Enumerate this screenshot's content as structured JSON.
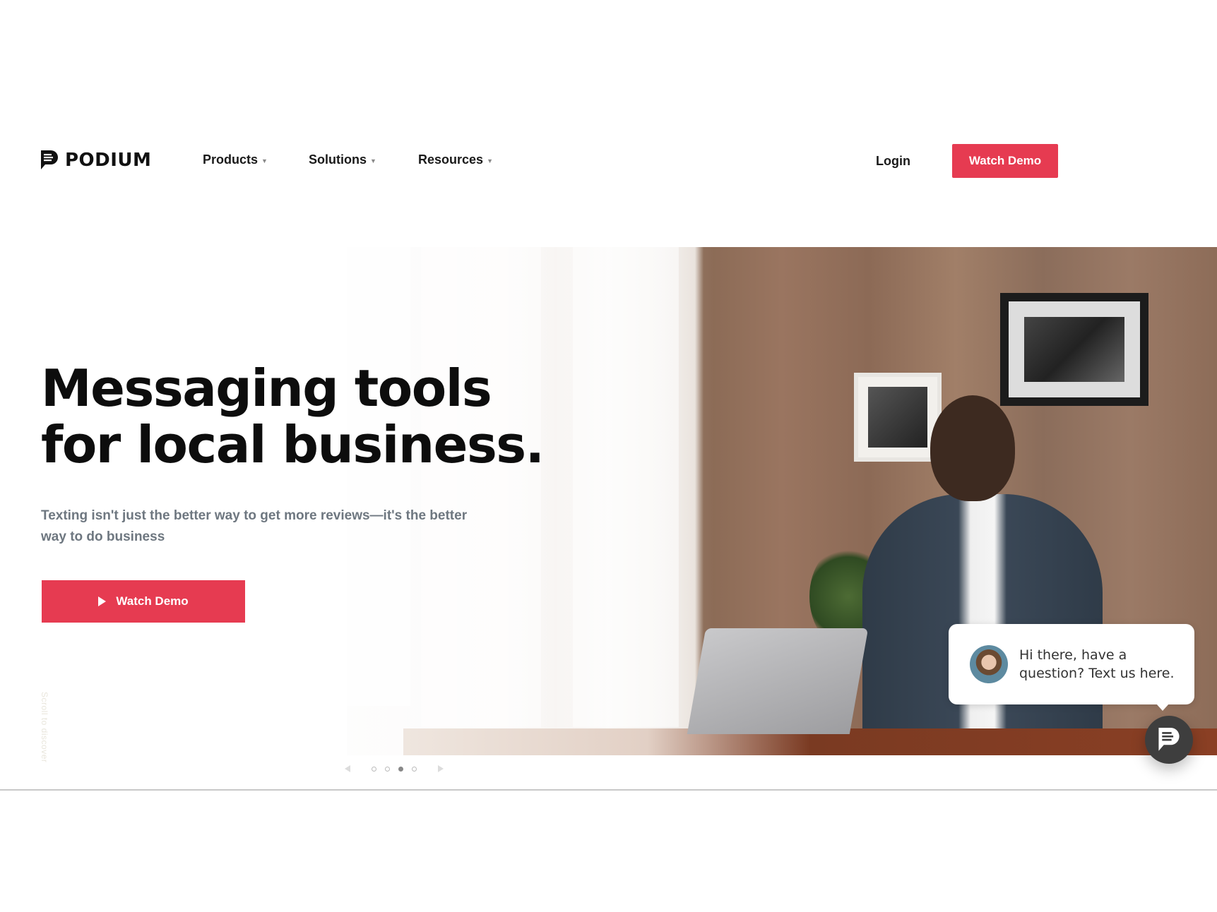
{
  "header": {
    "logo_text": "PODIUM",
    "nav": [
      {
        "label": "Products",
        "icon": "chevron-down-icon"
      },
      {
        "label": "Solutions",
        "icon": "chevron-down-icon"
      },
      {
        "label": "Resources",
        "icon": "chevron-down-icon"
      }
    ],
    "login_label": "Login",
    "watch_demo_label": "Watch Demo"
  },
  "hero": {
    "headline_line1": "Messaging tools",
    "headline_line2": "for local business.",
    "subtext": "Texting isn't just the better way to get more reviews—it's the better way to do business",
    "cta_label": "Watch Demo",
    "cta_icon": "play-icon",
    "scroll_hint": "Scroll to discover",
    "image_alt": "Businessman seated at desk with laptop in brick-walled office"
  },
  "carousel": {
    "slide_count": 4,
    "active_index": 2
  },
  "chat_widget": {
    "message": "Hi there, have a question? Text us here.",
    "launcher_icon": "chat-bubble-icon"
  },
  "colors": {
    "accent": "#e63b51",
    "subtext": "#6e7780",
    "chat_button": "#3e3e3e"
  }
}
